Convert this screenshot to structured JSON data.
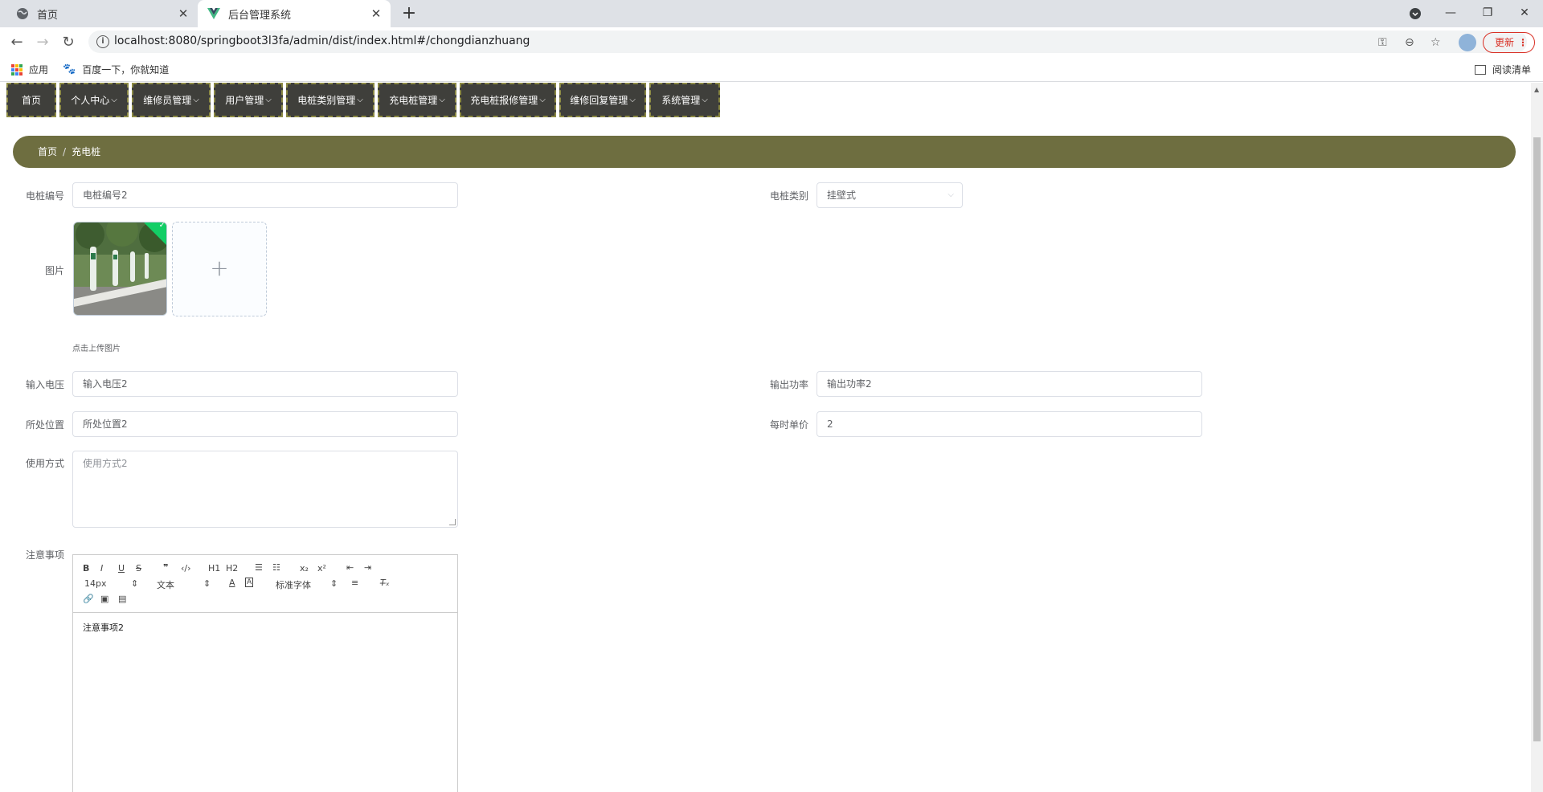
{
  "browser": {
    "tabs": [
      {
        "label": "首页",
        "active": false
      },
      {
        "label": "后台管理系统",
        "active": true
      }
    ],
    "url": "localhost:8080/springboot3l3fa/admin/dist/index.html#/chongdianzhuang",
    "update_label": "更新",
    "bookmarks": {
      "apps": "应用",
      "baidu": "百度一下，你就知道",
      "reading_list": "阅读清单"
    }
  },
  "nav": {
    "items": [
      "首页",
      "个人中心",
      "维修员管理",
      "用户管理",
      "电桩类别管理",
      "充电桩管理",
      "充电桩报修管理",
      "维修回复管理",
      "系统管理"
    ]
  },
  "breadcrumb": {
    "home": "首页",
    "sep": "/",
    "current": "充电桩"
  },
  "form": {
    "code": {
      "label": "电桩编号",
      "value": "电桩编号2"
    },
    "category": {
      "label": "电桩类别",
      "value": "挂壁式"
    },
    "image": {
      "label": "图片",
      "tip": "点击上传图片",
      "add_icon": "+"
    },
    "voltage": {
      "label": "输入电压",
      "value": "输入电压2"
    },
    "power": {
      "label": "输出功率",
      "value": "输出功率2"
    },
    "location": {
      "label": "所处位置",
      "value": "所处位置2"
    },
    "price": {
      "label": "每时单价",
      "value": "2"
    },
    "usage": {
      "label": "使用方式",
      "value": "使用方式2"
    },
    "notes": {
      "label": "注意事项",
      "value": "注意事项2"
    }
  },
  "editor": {
    "font_size": "14px",
    "heading": "文本",
    "font": "标准字体",
    "h1": "H1",
    "h2": "H2"
  },
  "colors": {
    "nav_bg": "#3f3f3b",
    "nav_border": "#8c8a45",
    "breadcrumb_bg": "#6e6e40",
    "success": "#13ce66"
  }
}
